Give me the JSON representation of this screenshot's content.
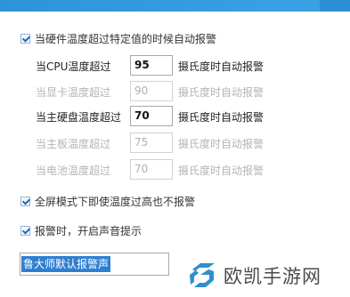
{
  "options": {
    "hw_alarm": {
      "label": "当硬件温度超过特定值的时候自动报警",
      "checked": true
    },
    "fullscreen_no_alarm": {
      "label": "全屏模式下即使温度过高也不报警",
      "checked": true
    },
    "alarm_sound": {
      "label": "报警时，开启声音提示",
      "checked": true
    }
  },
  "thresholds": [
    {
      "label": "当CPU温度超过",
      "value": "95",
      "unit": "摄氏度时自动报警",
      "enabled": true
    },
    {
      "label": "当显卡温度超过",
      "value": "90",
      "unit": "摄氏度时自动报警",
      "enabled": false
    },
    {
      "label": "当主硬盘温度超过",
      "value": "70",
      "unit": "摄氏度时自动报警",
      "enabled": true
    },
    {
      "label": "当主板温度超过",
      "value": "75",
      "unit": "摄氏度时自动报警",
      "enabled": false
    },
    {
      "label": "当电池温度超过",
      "value": "70",
      "unit": "摄氏度时自动报警",
      "enabled": false
    }
  ],
  "sound": {
    "selected": "鲁大师默认报警声"
  },
  "watermark": {
    "text": "欧凯手游网",
    "logo_icon": "ok-logo-icon"
  },
  "colors": {
    "titlebar": "#2f93d8",
    "selection": "#2f7fd1",
    "check": "#1d6db8",
    "logo": "#2e8fcf"
  }
}
